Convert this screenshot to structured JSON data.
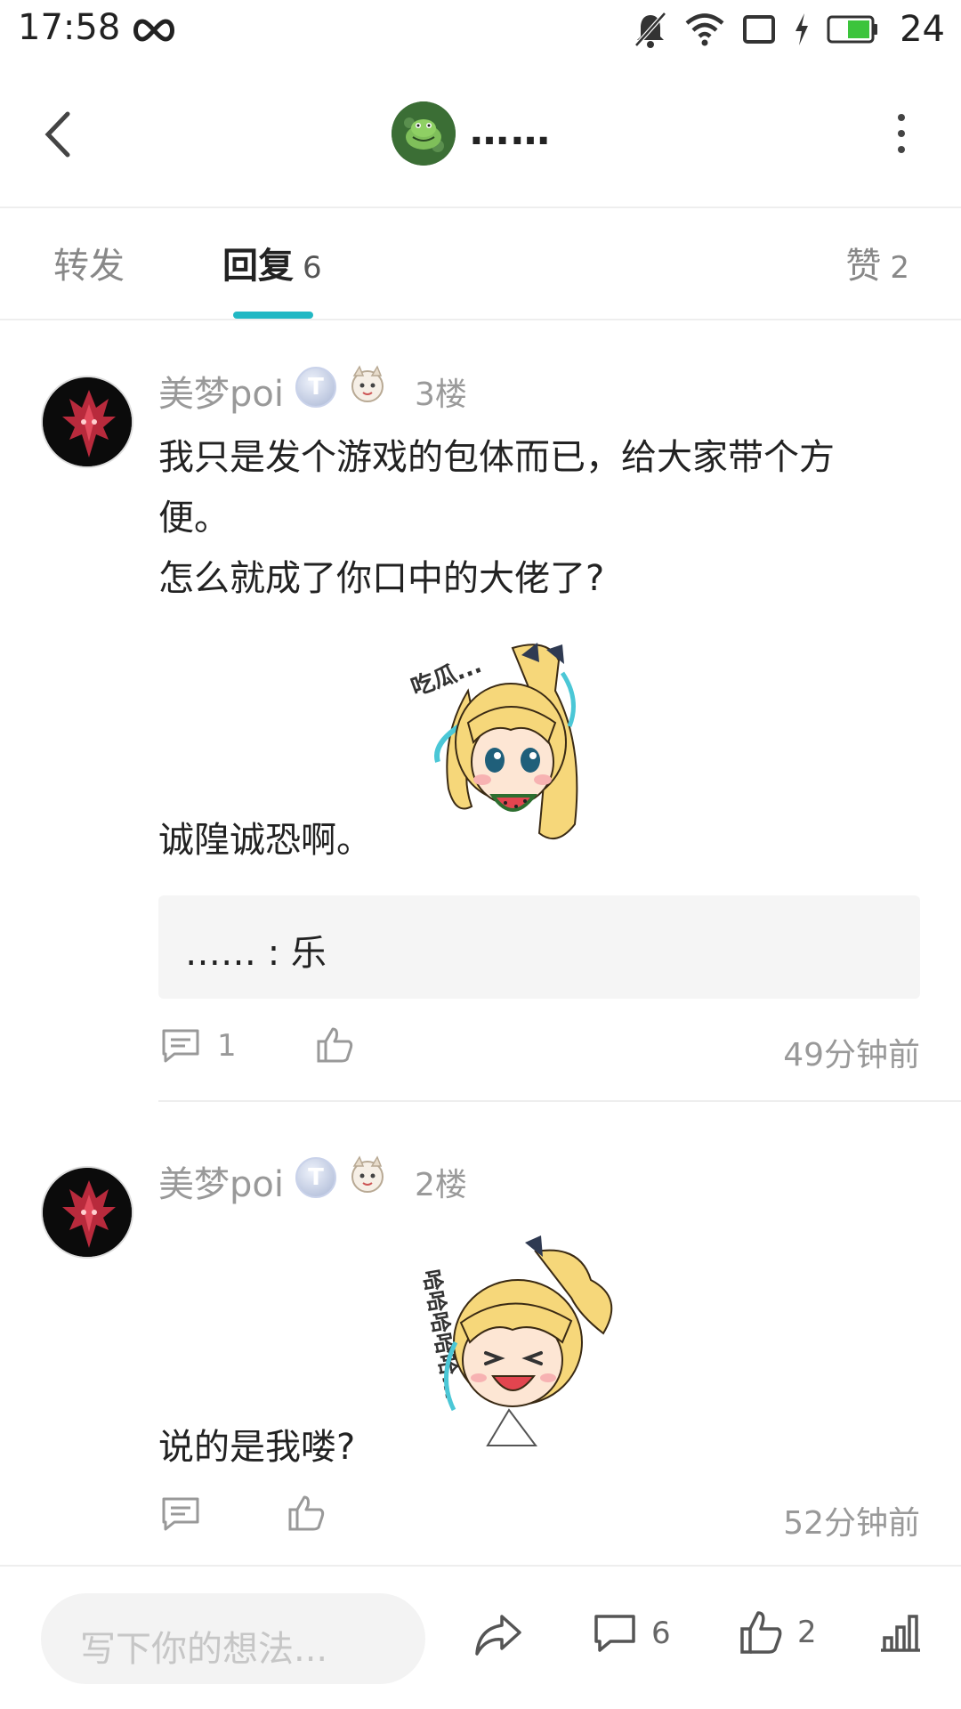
{
  "status_bar": {
    "time": "17:58",
    "battery": "24"
  },
  "header": {
    "title": "……"
  },
  "tabs": {
    "forward": {
      "label": "转发"
    },
    "reply": {
      "label": "回复",
      "count": "6"
    },
    "like": {
      "label": "赞",
      "count": "2"
    }
  },
  "posts": [
    {
      "username": "美梦poi",
      "level_badge": "T",
      "floor": "3楼",
      "text_lines": [
        "我只是发个游戏的包体而已，给大家带个方",
        "便。",
        "怎么就成了你口中的大佬了?"
      ],
      "text_after_sticker": "诚隍诚恐啊。",
      "sticker_caption": "吃瓜...",
      "quote": "…… : 乐",
      "reply_count": "1",
      "time": "49分钟前"
    },
    {
      "username": "美梦poi",
      "level_badge": "T",
      "floor": "2楼",
      "text_after_sticker": "说的是我喽?",
      "sticker_caption": "哈哈哈哈哈...",
      "time": "52分钟前"
    }
  ],
  "bottom_bar": {
    "input_placeholder": "写下你的想法...",
    "comment_count": "6",
    "like_count": "2"
  },
  "colors": {
    "accent": "#22b8c4",
    "text": "#222222",
    "muted": "#999999"
  }
}
